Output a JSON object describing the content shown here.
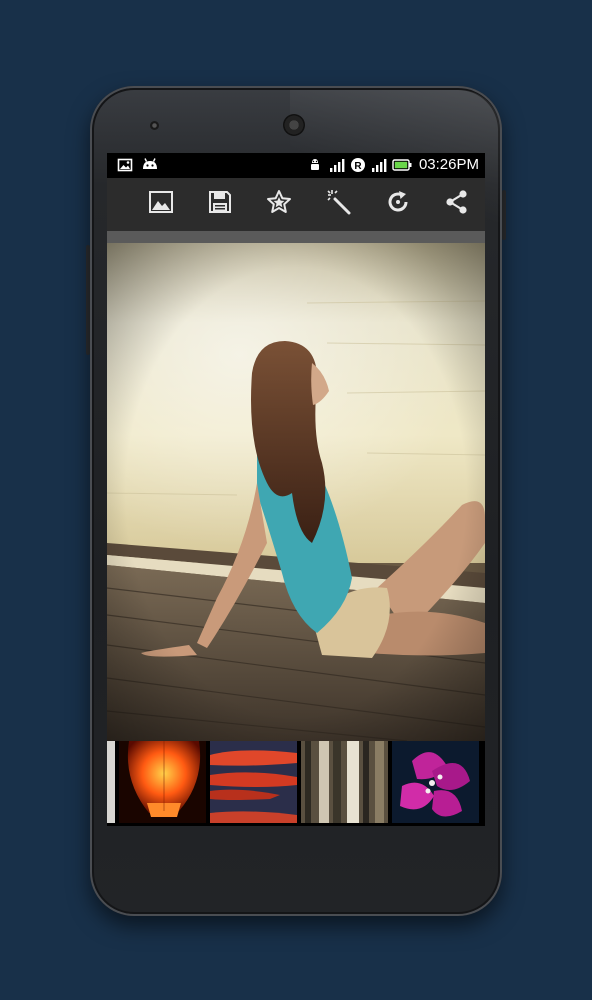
{
  "status_bar": {
    "time": "03:26PM",
    "left_icons": [
      "image-icon",
      "android-icon"
    ],
    "right_icons": [
      "data-transfer-icon",
      "signal-icon",
      "roaming-icon",
      "signal-icon",
      "battery-icon"
    ]
  },
  "toolbar": {
    "actions": [
      "gallery-icon",
      "save-icon",
      "favorite-icon",
      "magic-wand-icon",
      "refresh-icon",
      "share-icon"
    ]
  },
  "thumbnails": [
    "sky-lantern",
    "red-sunset-clouds",
    "forest-trees",
    "pink-flower"
  ],
  "colors": {
    "background": "#183049",
    "toolbar": "#2c2c2c",
    "battery": "#6ad64a"
  }
}
